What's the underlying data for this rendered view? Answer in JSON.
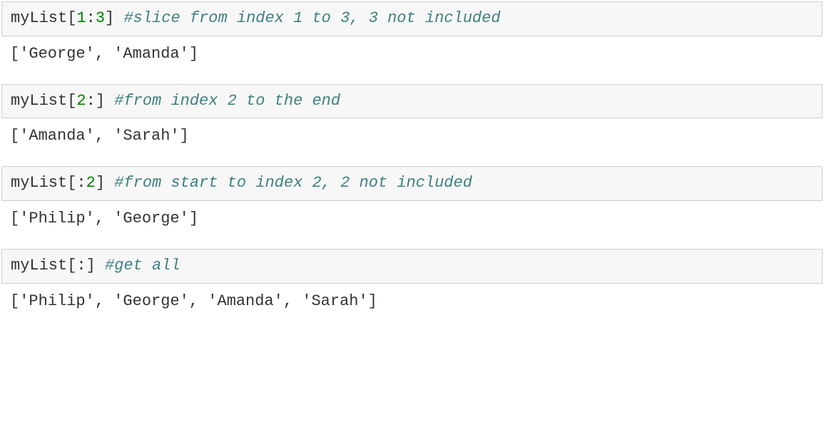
{
  "cells": [
    {
      "input": {
        "var": "myList",
        "slice_open": "[",
        "start": "1",
        "colon": ":",
        "end": "3",
        "slice_close": "] ",
        "comment": "#slice from index 1 to 3, 3 not included"
      },
      "output": "['George', 'Amanda']"
    },
    {
      "input": {
        "var": "myList",
        "slice_open": "[",
        "start": "2",
        "colon": ":",
        "end": "",
        "slice_close": "] ",
        "comment": "#from index 2 to the end"
      },
      "output": "['Amanda', 'Sarah']"
    },
    {
      "input": {
        "var": "myList",
        "slice_open": "[",
        "start": "",
        "colon": ":",
        "end": "2",
        "slice_close": "] ",
        "comment": "#from start to index 2, 2 not included"
      },
      "output": "['Philip', 'George']"
    },
    {
      "input": {
        "var": "myList",
        "slice_open": "[",
        "start": "",
        "colon": ":",
        "end": "",
        "slice_close": "] ",
        "comment": "#get all"
      },
      "output": "['Philip', 'George', 'Amanda', 'Sarah']"
    }
  ]
}
